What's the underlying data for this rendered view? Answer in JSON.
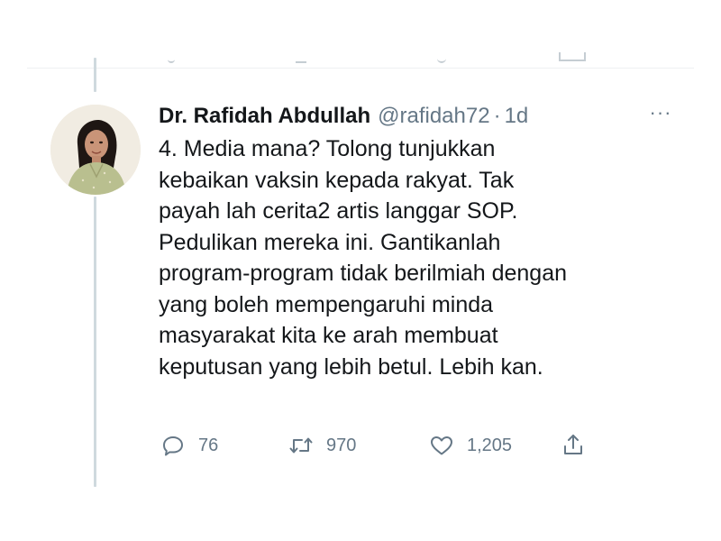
{
  "tweet": {
    "display_name": "Dr. Rafidah Abdullah",
    "handle": "@rafidah72",
    "separator": "·",
    "time": "1d",
    "more_label": "···",
    "lines": [
      "4. Media mana? Tolong tunjukkan",
      "kebaikan vaksin kepada rakyat. Tak",
      "payah lah cerita2 artis langgar SOP.",
      "Pedulikan mereka ini. Gantikanlah",
      "program-program tidak berilmiah dengan",
      "yang boleh mempengaruhi minda",
      "masyarakat kita ke arah membuat",
      "keputusan yang lebih betul. Lebih kan."
    ]
  },
  "actions": {
    "reply_count": "76",
    "retweet_count": "970",
    "like_count": "1,205"
  },
  "icons": {
    "reply": "reply-icon",
    "retweet": "retweet-icon",
    "like": "heart-icon",
    "share": "share-icon",
    "more": "more-icon"
  },
  "colors": {
    "text": "#14171a",
    "secondary": "#657786",
    "thread_line": "#cfd9de"
  }
}
